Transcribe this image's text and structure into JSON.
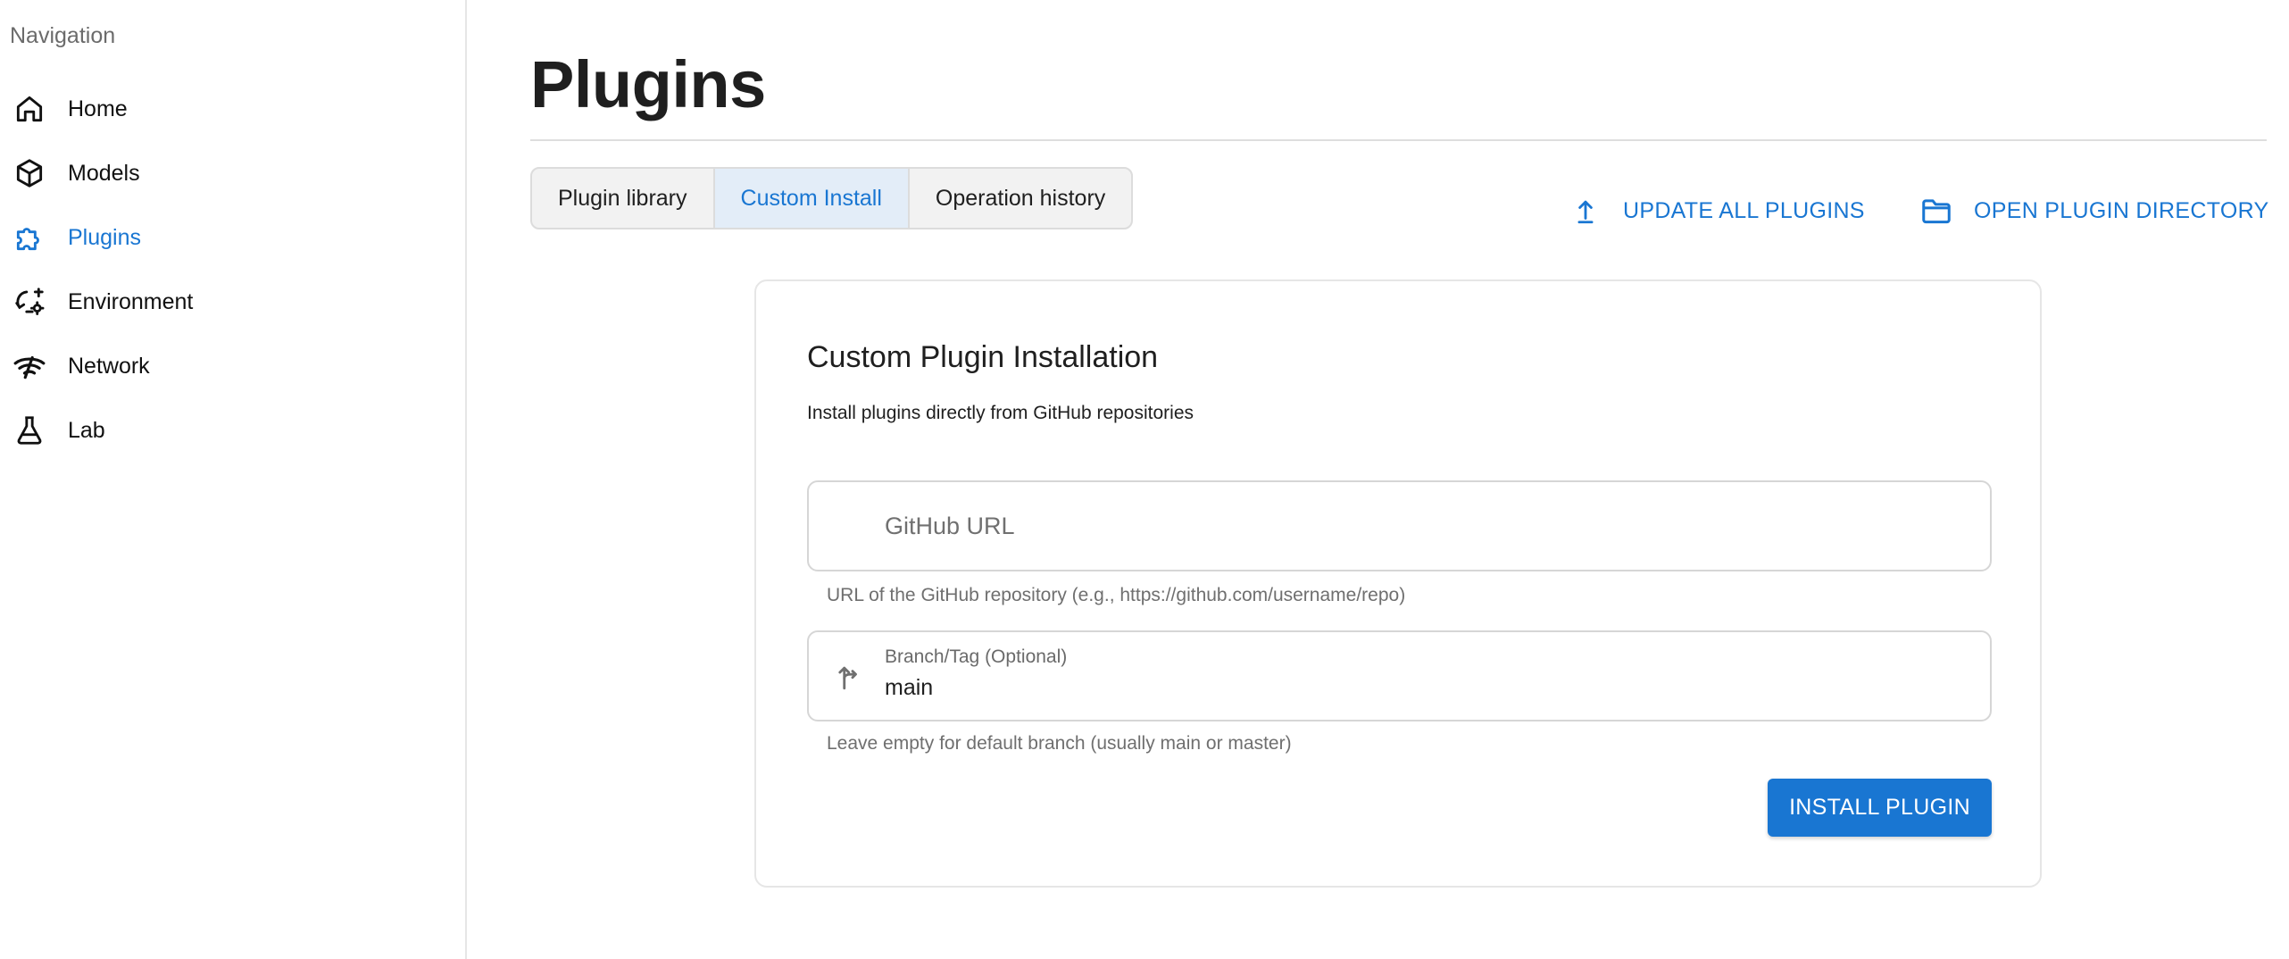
{
  "sidebar": {
    "heading": "Navigation",
    "items": [
      {
        "label": "Home",
        "icon": "home-icon"
      },
      {
        "label": "Models",
        "icon": "cube-icon"
      },
      {
        "label": "Plugins",
        "icon": "puzzle-icon",
        "active": true
      },
      {
        "label": "Environment",
        "icon": "environment-icon"
      },
      {
        "label": "Network",
        "icon": "network-icon"
      },
      {
        "label": "Lab",
        "icon": "flask-icon"
      }
    ]
  },
  "main": {
    "title": "Plugins",
    "tabs": [
      {
        "label": "Plugin library"
      },
      {
        "label": "Custom Install",
        "active": true
      },
      {
        "label": "Operation history"
      }
    ],
    "actions": {
      "update_all": "UPDATE ALL PLUGINS",
      "open_directory": "OPEN PLUGIN DIRECTORY"
    }
  },
  "card": {
    "title": "Custom Plugin Installation",
    "subtitle": "Install plugins directly from GitHub repositories",
    "github_url": {
      "placeholder": "GitHub URL",
      "value": "",
      "helper": "URL of the GitHub repository (e.g., https://github.com/username/repo)"
    },
    "branch": {
      "label": "Branch/Tag (Optional)",
      "value": "main",
      "helper": "Leave empty for default branch (usually main or master)"
    },
    "install_button": "INSTALL PLUGIN"
  },
  "colors": {
    "accent": "#1976d2",
    "active_tab_bg": "#e3edf8",
    "text": "#1f1f1f",
    "muted": "#6f6f6f"
  }
}
